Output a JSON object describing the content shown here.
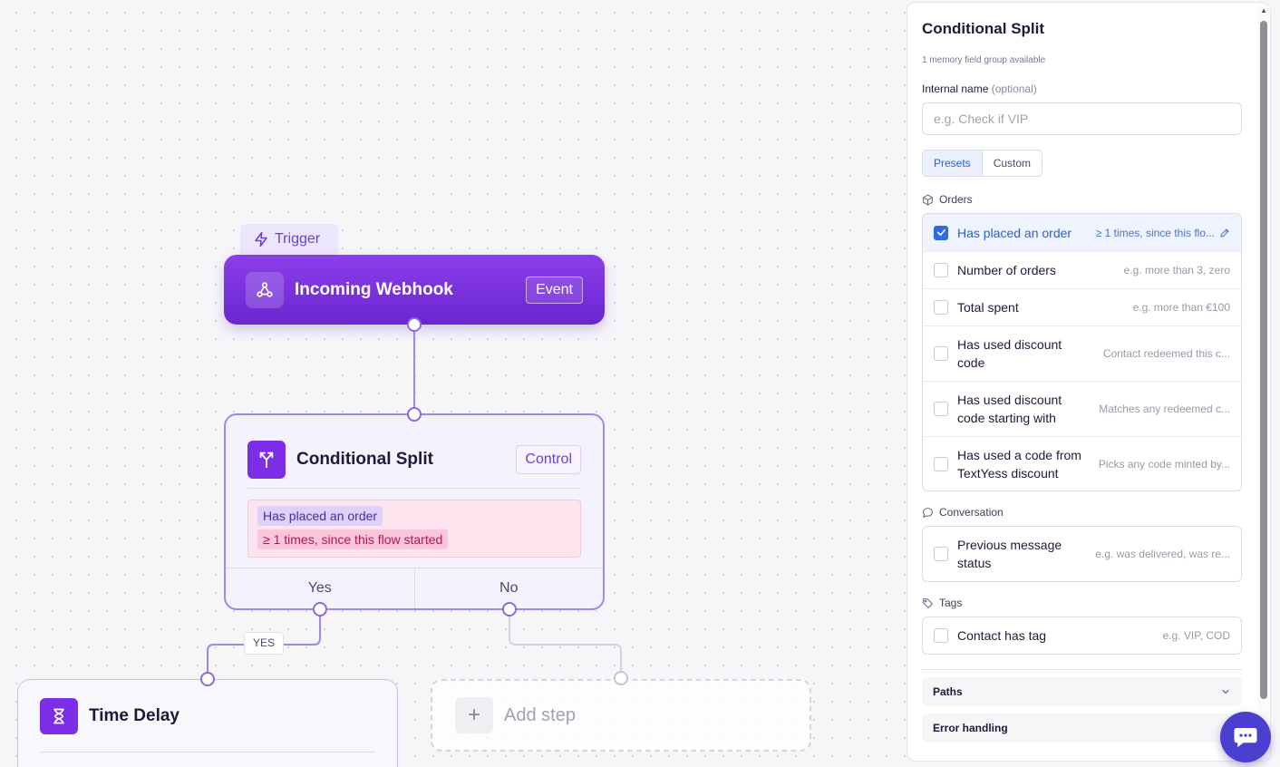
{
  "canvas": {
    "trigger_tab": "Trigger",
    "webhook_node": {
      "title": "Incoming Webhook",
      "badge": "Event"
    },
    "split_node": {
      "title": "Conditional Split",
      "badge": "Control",
      "condition_name": "Has placed an order",
      "condition_detail": "≥ 1 times, since this flow started",
      "yes_label": "Yes",
      "no_label": "No"
    },
    "yes_edge_label": "YES",
    "delay_node": {
      "title": "Time Delay"
    },
    "add_step": {
      "label": "Add step",
      "plus": "+"
    }
  },
  "panel": {
    "title": "Conditional Split",
    "subtitle": "1 memory field group available",
    "internal_name_label": "Internal name",
    "internal_name_optional": "(optional)",
    "internal_name_placeholder": "e.g. Check if VIP",
    "internal_name_value": "",
    "tabs": {
      "presets": "Presets",
      "custom": "Custom",
      "active": "Presets"
    },
    "groups": {
      "orders": {
        "title": "Orders",
        "items": [
          {
            "name": "Has placed an order",
            "hint": "≥ 1 times, since this flo...",
            "checked": true
          },
          {
            "name": "Number of orders",
            "hint": "e.g. more than 3, zero",
            "checked": false
          },
          {
            "name": "Total spent",
            "hint": "e.g. more than €100",
            "checked": false
          },
          {
            "name": "Has used discount code",
            "hint": "Contact redeemed this c...",
            "checked": false
          },
          {
            "name": "Has used discount code starting with",
            "hint": "Matches any redeemed c...",
            "checked": false
          },
          {
            "name": "Has used a code from TextYess discount",
            "hint": "Picks any code minted by...",
            "checked": false
          }
        ]
      },
      "conversation": {
        "title": "Conversation",
        "items": [
          {
            "name": "Previous message status",
            "hint": "e.g. was delivered, was re...",
            "checked": false
          }
        ]
      },
      "tags": {
        "title": "Tags",
        "items": [
          {
            "name": "Contact has tag",
            "hint": "e.g. VIP, COD",
            "checked": false
          }
        ]
      }
    },
    "paths_label": "Paths",
    "error_handling_label": "Error handling"
  },
  "colors": {
    "accent": "#6a26d1",
    "selected_blue": "#2f6be0",
    "condition_pink": "#fde4ef"
  }
}
